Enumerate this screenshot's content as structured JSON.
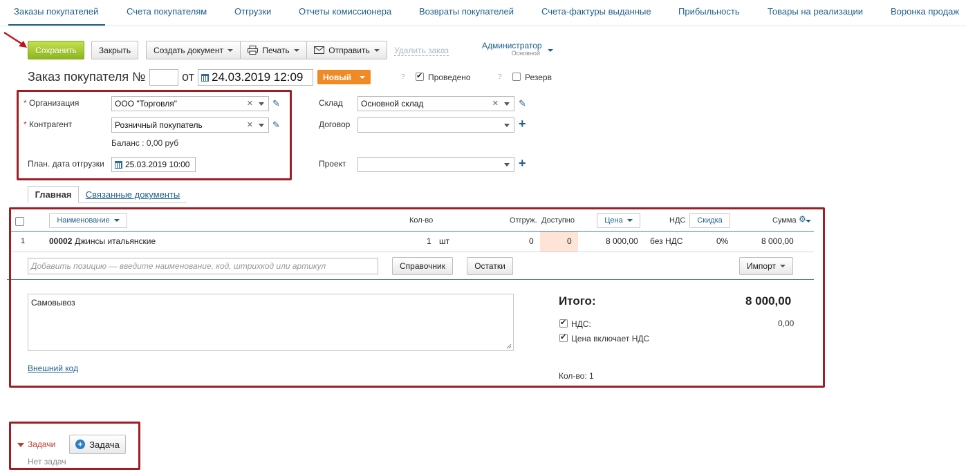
{
  "nav": {
    "items": [
      "Заказы покупателей",
      "Счета покупателям",
      "Отгрузки",
      "Отчеты комиссионера",
      "Возвраты покупателей",
      "Счета-фактуры выданные",
      "Прибыльность",
      "Товары на реализации",
      "Воронка продаж"
    ],
    "active_index": 0
  },
  "toolbar": {
    "save": "Сохранить",
    "close": "Закрыть",
    "create_doc": "Создать документ",
    "print": "Печать",
    "send": "Отправить",
    "delete": "Удалить заказ"
  },
  "user": {
    "name": "Администратор",
    "role": "Основной"
  },
  "header": {
    "title": "Заказ покупателя №",
    "number": "",
    "from_label": "от",
    "date": "24.03.2019 12:09",
    "status": "Новый",
    "posted_label": "Проведено",
    "posted": true,
    "reserve_label": "Резерв",
    "reserve": false,
    "help": "?"
  },
  "form": {
    "org_label": "Организация",
    "org_value": "ООО \"Торговля\"",
    "contractor_label": "Контрагент",
    "contractor_value": "Розничный покупатель",
    "balance": "Баланс : 0,00 руб",
    "ship_date_label": "План. дата отгрузки",
    "ship_date": "25.03.2019 10:00",
    "warehouse_label": "Склад",
    "warehouse_value": "Основной склад",
    "contract_label": "Договор",
    "contract_value": "",
    "project_label": "Проект",
    "project_value": "",
    "required_mark": "*"
  },
  "tabs": [
    "Главная",
    "Связанные документы"
  ],
  "table": {
    "headers": {
      "name": "Наименование",
      "qty": "Кол-во",
      "shipped": "Отгруж.",
      "available": "Доступно",
      "price": "Цена",
      "vat": "НДС",
      "discount": "Скидка",
      "sum": "Сумма"
    },
    "rows": [
      {
        "index": "1",
        "code": "00002",
        "name": "Джинсы итальянские",
        "qty": "1",
        "unit": "шт",
        "shipped": "0",
        "available": "0",
        "price": "8 000,00",
        "vat": "без НДС",
        "discount": "0%",
        "sum": "8 000,00"
      }
    ],
    "add_placeholder": "Добавить позицию — введите наименование, код, штрихкод или артикул",
    "catalog_btn": "Справочник",
    "stock_btn": "Остатки",
    "import_btn": "Импорт"
  },
  "footer": {
    "comment": "Самовывоз",
    "external_code": "Внешний код",
    "total_label": "Итого:",
    "total_value": "8 000,00",
    "vat_label": "НДС:",
    "vat_value": "0,00",
    "vat_checked": true,
    "price_incl_vat_label": "Цена включает НДС",
    "price_incl_vat_checked": true,
    "qty_summary": "Кол-во: 1"
  },
  "tasks": {
    "label": "Задачи",
    "add_btn": "Задача",
    "empty": "Нет задач"
  },
  "colors": {
    "accent": "#1d5f8a",
    "save_green": "#8cb71e",
    "status_orange": "#f08a24",
    "highlight_red": "#a31c24",
    "available_bg": "#fde4d6"
  }
}
